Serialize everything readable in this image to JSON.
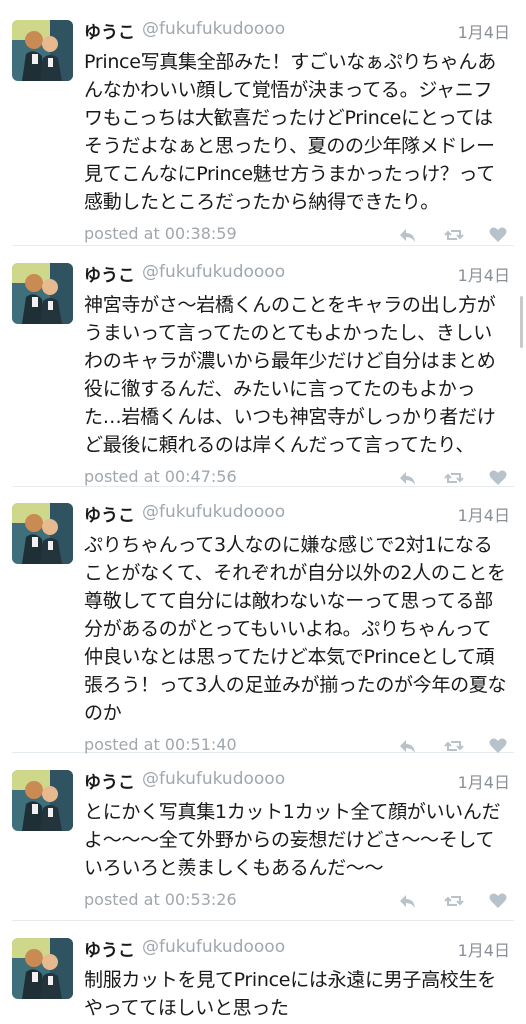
{
  "colors": {
    "text": "#1a1a1a",
    "secondary": "#a0a7ad",
    "icon": "#b8c2cb",
    "divider": "#e6ecf0"
  },
  "tweets": [
    {
      "name": "ゆうこ",
      "handle": "@fukufukudoooo",
      "date": "1月4日",
      "lines": [
        "Prince写真集全部みた！すごいなぁぷりちゃんあ",
        "んなかわいい顔して覚悟が決まってる。ジャニフ",
        "ワもこっちは大歓喜だったけどPrinceにとっては",
        "そうだよなぁと思ったり、夏のの少年隊メドレー",
        "見てこんなにPrince魅せ方うまかったっけ？って",
        "感動したところだったから納得できたり。"
      ],
      "posted": "posted at 00:38:59",
      "icons": [
        "reply-icon",
        "retweet-icon",
        "like-icon"
      ]
    },
    {
      "name": "ゆうこ",
      "handle": "@fukufukudoooo",
      "date": "1月4日",
      "lines": [
        "神宮寺がさ〜岩橋くんのことをキャラの出し方が",
        "うまいって言ってたのとてもよかったし、きしい",
        "わのキャラが濃いから最年少だけど自分はまとめ",
        "役に徹するんだ、みたいに言ってたのもよかっ",
        "た…岩橋くんは、いつも神宮寺がしっかり者だけ",
        "ど最後に頼れるのは岸くんだって言ってたり、"
      ],
      "posted": "posted at 00:47:56",
      "icons": [
        "reply-icon",
        "retweet-icon",
        "like-icon"
      ]
    },
    {
      "name": "ゆうこ",
      "handle": "@fukufukudoooo",
      "date": "1月4日",
      "lines": [
        "ぷりちゃんって3人なのに嫌な感じで2対1になる",
        "ことがなくて、それぞれが自分以外の2人のことを",
        "尊敬してて自分には敵わないなーって思ってる部",
        "分があるのがとってもいいよね。ぷりちゃんって",
        "仲良いなとは思ってたけど本気でPrinceとして頑",
        "張ろう！って3人の足並みが揃ったのが今年の夏な",
        "のか"
      ],
      "posted": "posted at 00:51:40",
      "icons": [
        "reply-icon",
        "retweet-icon",
        "like-icon"
      ]
    },
    {
      "name": "ゆうこ",
      "handle": "@fukufukudoooo",
      "date": "1月4日",
      "lines": [
        "とにかく写真集1カット1カット全て顔がいいんだ",
        "よ〜〜〜全て外野からの妄想だけどさ〜〜そして",
        "いろいろと羨ましくもあるんだ〜〜"
      ],
      "posted": "posted at 00:53:26",
      "icons": [
        "reply-icon",
        "retweet-icon",
        "like-icon"
      ]
    },
    {
      "name": "ゆうこ",
      "handle": "@fukufukudoooo",
      "date": "1月4日",
      "lines": [
        "制服カットを見てPrinceには永遠に男子高校生を",
        "やっててほしいと思った"
      ],
      "posted": "",
      "icons": []
    }
  ]
}
